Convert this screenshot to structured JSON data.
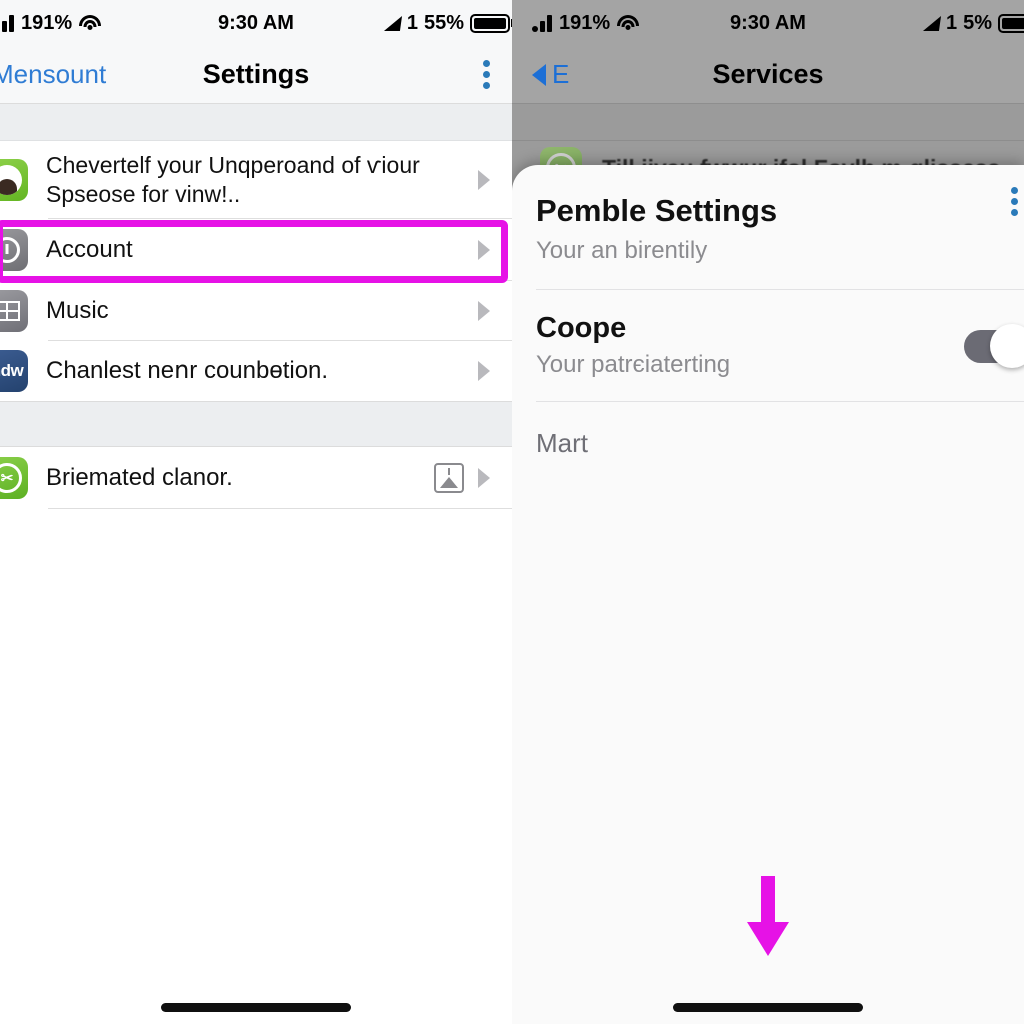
{
  "left_phone": {
    "status_bar": {
      "carrier_percent": "191%",
      "time": "9:30 AM",
      "signal_number": "1",
      "battery_percent": "55%",
      "wifi_icon": "wifi-icon",
      "bars_icon": "cellular-bars-icon",
      "signal_icon": "signal-arrow-icon",
      "battery_icon": "battery-icon"
    },
    "nav_bar": {
      "back_label": "Mensount",
      "title": "Settings",
      "menu_icon": "kebab-menu-icon"
    },
    "rows": [
      {
        "icon": "profile-avatar-icon",
        "label": "Chevertelf your Unqperoand of ѵiour Spseose for vinw!..",
        "accessory": "chevron-right-icon"
      },
      {
        "icon": "clock-icon",
        "label": "Account",
        "accessory": "chevron-right-icon",
        "highlighted": true
      },
      {
        "icon": "music-grid-icon",
        "label": "Music",
        "accessory": "chevron-right-icon"
      },
      {
        "icon": "ndw-badge-icon",
        "label": "Chanlest neոr counbɵtion.",
        "accessory": "chevron-right-icon"
      }
    ],
    "rows_second_section": [
      {
        "icon": "green-scissors-icon",
        "label": "Briemated clanor.",
        "badge": "picture-frame-icon",
        "accessory": "chevron-right-icon"
      }
    ],
    "highlight_color": "#e612e6"
  },
  "right_phone": {
    "status_bar": {
      "carrier_percent": "191%",
      "time": "9:30 AM",
      "signal_number": "1",
      "battery_percent": "5%",
      "wifi_icon": "wifi-icon",
      "bars_icon": "cellular-bars-icon",
      "signal_icon": "signal-arrow-icon",
      "battery_icon": "battery-icon"
    },
    "nav_bar": {
      "back_label": "E",
      "title": "Services",
      "back_icon": "chevron-left-icon"
    },
    "dimmed_row": {
      "icon": "green-app-icon",
      "label": "Till iivau fwwur ifol Fovlb m-glissess"
    },
    "sheet": {
      "title": "Pemble Settings",
      "subtitle": "Your an birentily",
      "menu_icon": "kebab-menu-icon",
      "row": {
        "title": "Coope",
        "subtitle": "Your patrєiaterting",
        "toggle_state": "off",
        "toggle_icon": "toggle-switch"
      },
      "section_label": "Mart"
    },
    "annotation": {
      "arrow_icon": "down-arrow-annotation",
      "color": "#e612e6"
    }
  }
}
